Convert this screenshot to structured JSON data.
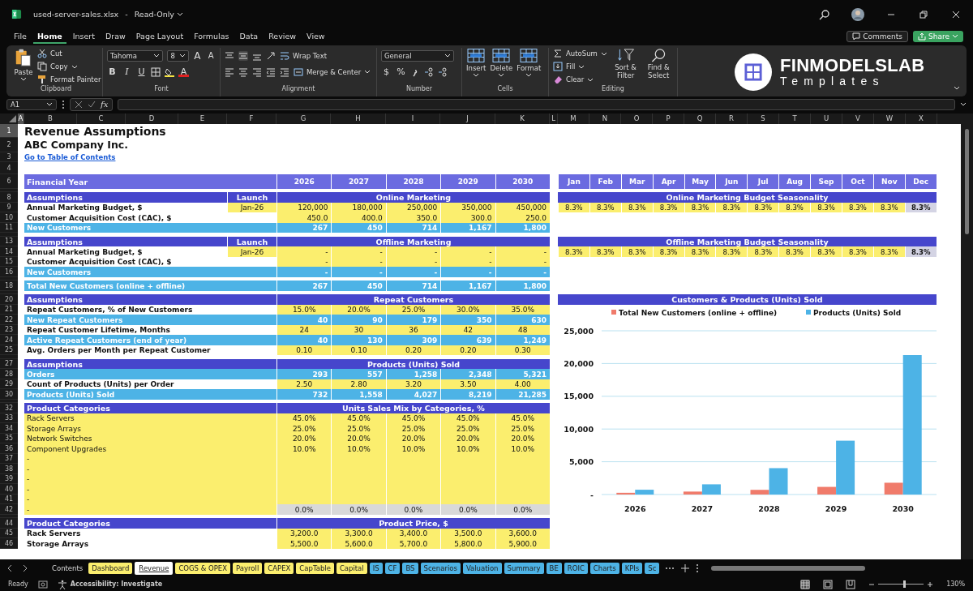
{
  "window": {
    "title": "used-server-sales.xlsx",
    "separator": "-",
    "mode": "Read-Only"
  },
  "menu": [
    {
      "label": "File",
      "selected": false
    },
    {
      "label": "Home",
      "selected": true
    },
    {
      "label": "Insert",
      "selected": false
    },
    {
      "label": "Draw",
      "selected": false
    },
    {
      "label": "Page Layout",
      "selected": false
    },
    {
      "label": "Formulas",
      "selected": false
    },
    {
      "label": "Data",
      "selected": false
    },
    {
      "label": "Review",
      "selected": false
    },
    {
      "label": "View",
      "selected": false
    }
  ],
  "header_buttons": {
    "comments": "Comments",
    "share": "Share"
  },
  "ribbon": {
    "clipboard": {
      "name": "Clipboard",
      "paste": "Paste",
      "cut": "Cut",
      "copy": "Copy",
      "painter": "Format Painter"
    },
    "font": {
      "name": "Font",
      "family": "Tahoma",
      "size": "8",
      "grow": "A",
      "shrink": "A",
      "bold": "B",
      "italic": "I",
      "underline": "U",
      "color_letter": "A"
    },
    "alignment": {
      "name": "Alignment",
      "wrap": "Wrap Text",
      "merge": "Merge & Center"
    },
    "number": {
      "name": "Number",
      "format": "General",
      "currency": "$",
      "percent": "%"
    },
    "cells": {
      "name": "Cells",
      "items": [
        "Insert",
        "Delete",
        "Format"
      ]
    },
    "editing": {
      "name": "Editing",
      "autosum": "AutoSum",
      "fill": "Fill",
      "clear": "Clear",
      "sort": "Sort & Filter",
      "find": "Find & Select"
    },
    "logo": {
      "brand": "FINMODELSLAB",
      "tagline": "Templates"
    }
  },
  "formula_bar": {
    "name_box": "A1",
    "fx": "fx"
  },
  "columns": [
    {
      "label": "A",
      "selected": true
    },
    {
      "label": "B",
      "selected": false
    },
    {
      "label": "C",
      "selected": false
    },
    {
      "label": "D",
      "selected": false
    },
    {
      "label": "E",
      "selected": false
    },
    {
      "label": "F",
      "selected": false
    },
    {
      "label": "G",
      "selected": false
    },
    {
      "label": "H",
      "selected": false
    },
    {
      "label": "I",
      "selected": false
    },
    {
      "label": "J",
      "selected": false
    },
    {
      "label": "K",
      "selected": false
    },
    {
      "label": "L",
      "selected": false
    },
    {
      "label": "M",
      "selected": false
    },
    {
      "label": "N",
      "selected": false
    },
    {
      "label": "O",
      "selected": false
    },
    {
      "label": "P",
      "selected": false
    },
    {
      "label": "Q",
      "selected": false
    },
    {
      "label": "R",
      "selected": false
    },
    {
      "label": "S",
      "selected": false
    },
    {
      "label": "T",
      "selected": false
    },
    {
      "label": "U",
      "selected": false
    },
    {
      "label": "V",
      "selected": false
    },
    {
      "label": "W",
      "selected": false
    },
    {
      "label": "X",
      "selected": false
    }
  ],
  "rows": [
    {
      "num": "1",
      "kind": "title",
      "label": "Revenue Assumptions",
      "selected": true
    },
    {
      "num": "2",
      "kind": "subtitle",
      "label": "ABC Company Inc.",
      "selected": false
    },
    {
      "num": "3",
      "kind": "link",
      "label": "Go to Table of Contents",
      "selected": false
    },
    {
      "num": "4",
      "kind": "blank",
      "selected": false
    },
    {
      "num": "6",
      "kind": "years",
      "label": "Financial Year",
      "values": [
        "2026",
        "2027",
        "2028",
        "2029",
        "2030"
      ],
      "selected": false,
      "right": {
        "kind": "months",
        "values": [
          "Jan",
          "Feb",
          "Mar",
          "Apr",
          "May",
          "Jun",
          "Jul",
          "Aug",
          "Sep",
          "Oct",
          "Nov",
          "Dec"
        ]
      }
    },
    {
      "kind": "gap"
    },
    {
      "num": "8",
      "kind": "section",
      "label": "Assumptions",
      "launch": "Launch",
      "title": "Online Marketing",
      "selected": false,
      "right": {
        "kind": "section",
        "title": "Online Marketing Budget Seasonality"
      }
    },
    {
      "num": "9",
      "kind": "amount",
      "label": "Annual Marketing Budget, $",
      "launch": "Jan-26",
      "values": [
        "120,000",
        "180,000",
        "250,000",
        "350,000",
        "450,000"
      ],
      "selected": false,
      "right": {
        "kind": "shares",
        "values": [
          {
            "text": "8.3%",
            "total": false
          },
          {
            "text": "8.3%",
            "total": false
          },
          {
            "text": "8.3%",
            "total": false
          },
          {
            "text": "8.3%",
            "total": false
          },
          {
            "text": "8.3%",
            "total": false
          },
          {
            "text": "8.3%",
            "total": false
          },
          {
            "text": "8.3%",
            "total": false
          },
          {
            "text": "8.3%",
            "total": false
          },
          {
            "text": "8.3%",
            "total": false
          },
          {
            "text": "8.3%",
            "total": false
          },
          {
            "text": "8.3%",
            "total": false
          },
          {
            "text": "8.3%",
            "total": true
          }
        ]
      }
    },
    {
      "num": "10",
      "kind": "amount",
      "label": "Customer Acquisition Cost (CAC), $",
      "values": [
        "450.0",
        "400.0",
        "350.0",
        "300.0",
        "250.0"
      ],
      "selected": false
    },
    {
      "num": "11",
      "kind": "calc",
      "label": "New Customers",
      "values": [
        "267",
        "450",
        "714",
        "1,167",
        "1,800"
      ],
      "selected": false
    },
    {
      "kind": "gap"
    },
    {
      "num": "13",
      "kind": "section",
      "label": "Assumptions",
      "launch": "Launch",
      "title": "Offline Marketing",
      "selected": false,
      "right": {
        "kind": "section",
        "title": "Offline Marketing Budget Seasonality"
      }
    },
    {
      "num": "14",
      "kind": "amount",
      "label": "Annual Marketing Budget, $",
      "launch": "Jan-26",
      "values": [
        "-",
        "-",
        "-",
        "-",
        "-"
      ],
      "selected": false,
      "right": {
        "kind": "shares",
        "values": [
          {
            "text": "8.3%",
            "total": false
          },
          {
            "text": "8.3%",
            "total": false
          },
          {
            "text": "8.3%",
            "total": false
          },
          {
            "text": "8.3%",
            "total": false
          },
          {
            "text": "8.3%",
            "total": false
          },
          {
            "text": "8.3%",
            "total": false
          },
          {
            "text": "8.3%",
            "total": false
          },
          {
            "text": "8.3%",
            "total": false
          },
          {
            "text": "8.3%",
            "total": false
          },
          {
            "text": "8.3%",
            "total": false
          },
          {
            "text": "8.3%",
            "total": false
          },
          {
            "text": "8.3%",
            "total": true
          }
        ]
      }
    },
    {
      "num": "15",
      "kind": "amount",
      "label": "Customer Acquisition Cost (CAC), $",
      "values": [
        "-",
        "-",
        "-",
        "-",
        "-"
      ],
      "selected": false
    },
    {
      "num": "16",
      "kind": "calc",
      "label": "New Customers",
      "values": [
        "-",
        "-",
        "-",
        "-",
        "-"
      ],
      "selected": false
    },
    {
      "kind": "gap"
    },
    {
      "num": "18",
      "kind": "calc",
      "label": "Total New Customers (online + offline)",
      "values": [
        "267",
        "450",
        "714",
        "1,167",
        "1,800"
      ],
      "selected": false
    },
    {
      "kind": "gap"
    },
    {
      "num": "20",
      "kind": "section",
      "label": "Assumptions",
      "title": "Repeat Customers",
      "selected": false,
      "right": {
        "kind": "chart",
        "title": "Customers & Products (Units) Sold",
        "chart_data": {
          "type": "bar",
          "categories": [
            "2026",
            "2027",
            "2028",
            "2029",
            "2030"
          ],
          "series": [
            {
              "name": "Total New Customers (online + offline)",
              "color": "#f07b6b",
              "values": [
                267,
                450,
                714,
                1167,
                1800
              ]
            },
            {
              "name": "Products (Units) Sold",
              "color": "#4db3e6",
              "values": [
                732,
                1558,
                4027,
                8219,
                21285
              ]
            }
          ],
          "ylim": [
            0,
            25000
          ],
          "yticks": [
            {
              "value": 0,
              "label": "-"
            },
            {
              "value": 5000,
              "label": "5,000"
            },
            {
              "value": 10000,
              "label": "10,000"
            },
            {
              "value": 15000,
              "label": "15,000"
            },
            {
              "value": 20000,
              "label": "20,000"
            },
            {
              "value": 25000,
              "label": "25,000"
            }
          ],
          "grid": true,
          "legend": true
        }
      }
    },
    {
      "num": "21",
      "kind": "input",
      "label": "Repeat Customers, % of New Customers",
      "values": [
        "15.0%",
        "20.0%",
        "25.0%",
        "30.0%",
        "35.0%"
      ],
      "selected": false
    },
    {
      "num": "22",
      "kind": "calc",
      "label": "New Repeat Customers",
      "values": [
        "40",
        "90",
        "179",
        "350",
        "630"
      ],
      "selected": false
    },
    {
      "num": "23",
      "kind": "input",
      "label": "Repeat Customer Lifetime, Months",
      "values": [
        "24",
        "30",
        "36",
        "42",
        "48"
      ],
      "selected": false
    },
    {
      "num": "24",
      "kind": "calc",
      "label": "Active Repeat Customers (end of year)",
      "values": [
        "40",
        "130",
        "309",
        "639",
        "1,249"
      ],
      "selected": false
    },
    {
      "num": "25",
      "kind": "input",
      "label": "Avg. Orders per Month per Repeat Customer",
      "values": [
        "0.10",
        "0.10",
        "0.20",
        "0.20",
        "0.30"
      ],
      "selected": false
    },
    {
      "kind": "gap"
    },
    {
      "num": "27",
      "kind": "section",
      "label": "Assumptions",
      "title": "Products (Units) Sold",
      "selected": false
    },
    {
      "num": "28",
      "kind": "calc",
      "label": "Orders",
      "values": [
        "293",
        "557",
        "1,258",
        "2,348",
        "5,321"
      ],
      "selected": false
    },
    {
      "num": "29",
      "kind": "input",
      "label": "Count of Products (Units) per Order",
      "values": [
        "2.50",
        "2.80",
        "3.20",
        "3.50",
        "4.00"
      ],
      "selected": false
    },
    {
      "num": "30",
      "kind": "calc",
      "label": "Products (Units) Sold",
      "values": [
        "732",
        "1,558",
        "4,027",
        "8,219",
        "21,285"
      ],
      "selected": false
    },
    {
      "kind": "gap"
    },
    {
      "num": "32",
      "kind": "section",
      "label": "Product Categories",
      "title": "Units Sales Mix by Categories, %",
      "selected": false
    },
    {
      "num": "33",
      "kind": "category",
      "label": "Rack Servers",
      "values": [
        "45.0%",
        "45.0%",
        "45.0%",
        "45.0%",
        "45.0%"
      ],
      "selected": false
    },
    {
      "num": "34",
      "kind": "category",
      "label": "Storage Arrays",
      "values": [
        "25.0%",
        "25.0%",
        "25.0%",
        "25.0%",
        "25.0%"
      ],
      "selected": false
    },
    {
      "num": "35",
      "kind": "category",
      "label": "Network Switches",
      "values": [
        "20.0%",
        "20.0%",
        "20.0%",
        "20.0%",
        "20.0%"
      ],
      "selected": false
    },
    {
      "num": "36",
      "kind": "category",
      "label": "Component Upgrades",
      "values": [
        "10.0%",
        "10.0%",
        "10.0%",
        "10.0%",
        "10.0%"
      ],
      "selected": false
    },
    {
      "num": "37",
      "kind": "category",
      "label": "-",
      "selected": false
    },
    {
      "num": "38",
      "kind": "category",
      "label": "-",
      "selected": false
    },
    {
      "num": "39",
      "kind": "category",
      "label": "-",
      "selected": false
    },
    {
      "num": "40",
      "kind": "category",
      "label": "-",
      "selected": false
    },
    {
      "num": "41",
      "kind": "category",
      "label": "-",
      "selected": false
    },
    {
      "num": "42",
      "kind": "check",
      "label": "-",
      "values": [
        "0.0%",
        "0.0%",
        "0.0%",
        "0.0%",
        "0.0%"
      ],
      "selected": false
    },
    {
      "kind": "gap"
    },
    {
      "num": "44",
      "kind": "section",
      "label": "Product Categories",
      "title": "Product Price, $",
      "selected": false
    },
    {
      "num": "45",
      "kind": "input",
      "label": "Rack Servers",
      "values": [
        "3,200.0",
        "3,300.0",
        "3,400.0",
        "3,500.0",
        "3,600.0"
      ],
      "selected": false
    },
    {
      "num": "46",
      "kind": "input",
      "label": "Storage Arrays",
      "values": [
        "5,500.0",
        "5,600.0",
        "5,700.0",
        "5,800.0",
        "5,900.0"
      ],
      "selected": false
    }
  ],
  "sheet_tabs": [
    {
      "label": "Contents",
      "selected": false
    },
    {
      "label": "Dashboard",
      "selected": false,
      "color": "#fbee6e"
    },
    {
      "label": "Revenue",
      "selected": true
    },
    {
      "label": "COGS & OPEX",
      "selected": false,
      "color": "#fbee6e"
    },
    {
      "label": "Payroll",
      "selected": false,
      "color": "#fbee6e"
    },
    {
      "label": "CAPEX",
      "selected": false,
      "color": "#fbee6e"
    },
    {
      "label": "CapTable",
      "selected": false,
      "color": "#fbee6e"
    },
    {
      "label": "Capital",
      "selected": false,
      "color": "#fbee6e"
    },
    {
      "label": "IS",
      "selected": false,
      "color": "#4db3e6"
    },
    {
      "label": "CF",
      "selected": false,
      "color": "#4db3e6"
    },
    {
      "label": "BS",
      "selected": false,
      "color": "#4db3e6"
    },
    {
      "label": "Scenarios",
      "selected": false,
      "color": "#4db3e6"
    },
    {
      "label": "Valuation",
      "selected": false,
      "color": "#4db3e6"
    },
    {
      "label": "Summary",
      "selected": false,
      "color": "#4db3e6"
    },
    {
      "label": "BE",
      "selected": false,
      "color": "#4db3e6"
    },
    {
      "label": "ROIC",
      "selected": false,
      "color": "#4db3e6"
    },
    {
      "label": "Charts",
      "selected": false,
      "color": "#4db3e6"
    },
    {
      "label": "KPIs",
      "selected": false,
      "color": "#4db3e6"
    },
    {
      "label": "Sc",
      "selected": false,
      "color": "#4db3e6"
    }
  ],
  "status_bar": {
    "state": "Ready",
    "accessibility": "Accessibility: Investigate",
    "zoom": "130%",
    "zoom_slider": {
      "level": 0.55
    }
  }
}
